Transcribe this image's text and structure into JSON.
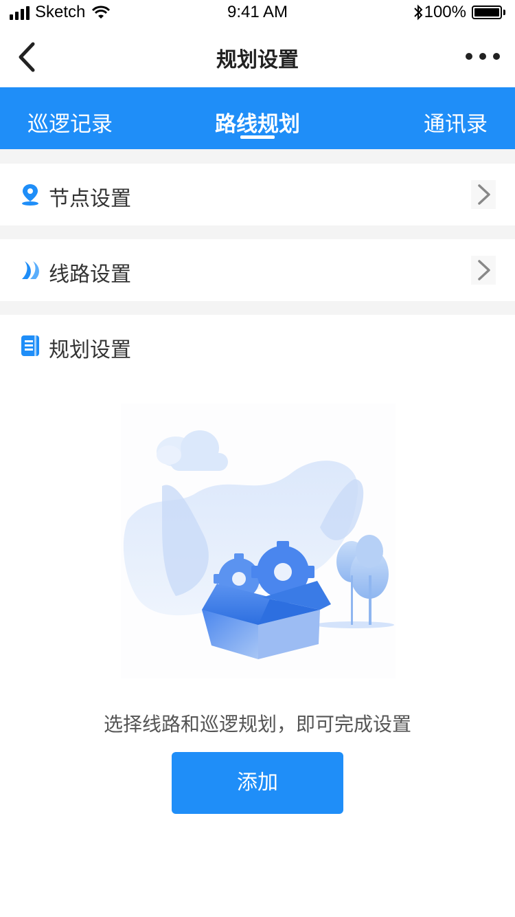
{
  "status_bar": {
    "carrier": "Sketch",
    "time": "9:41 AM",
    "battery": "100%"
  },
  "nav": {
    "title": "规划设置"
  },
  "tabs": [
    {
      "label": "巡逻记录",
      "active": false
    },
    {
      "label": "路线规划",
      "active": true
    },
    {
      "label": "通讯录",
      "active": false
    }
  ],
  "rows": {
    "node": {
      "label": "节点设置",
      "icon": "location-pin-icon"
    },
    "route": {
      "label": "线路设置",
      "icon": "route-icon"
    },
    "plan": {
      "label": "规划设置",
      "icon": "document-icon"
    }
  },
  "empty_state": {
    "message": "选择线路和巡逻规划，即可完成设置",
    "button_label": "添加"
  },
  "colors": {
    "accent": "#1f8ef8",
    "separator": "#f4f4f4"
  }
}
